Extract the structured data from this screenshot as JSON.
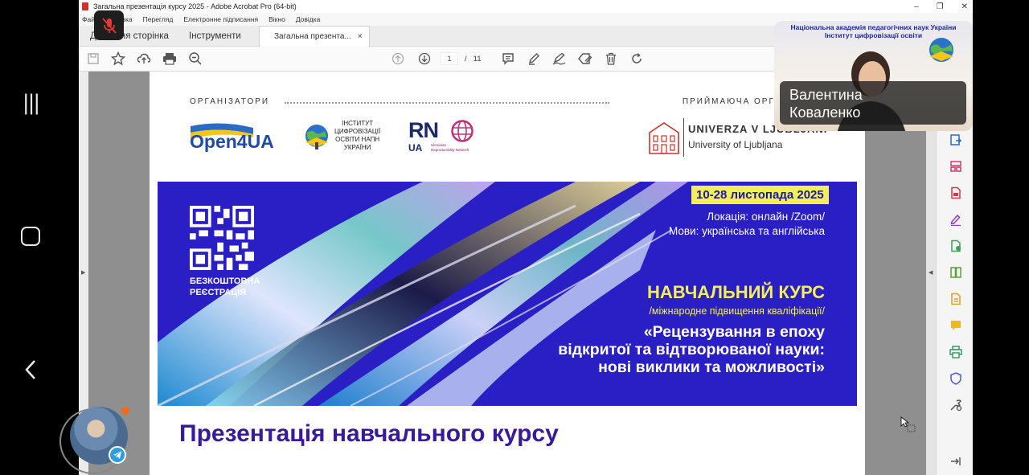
{
  "window": {
    "title": "Загальна презентація  курсу 2025 - Adobe Acrobat Pro (64-bit)",
    "controls": {
      "minimize": "–",
      "restore": "❐",
      "close": "✕"
    }
  },
  "menu": [
    "Файл",
    "Правка",
    "Перегляд",
    "Електронне підписання",
    "Вікно",
    "Довідка"
  ],
  "tabs": {
    "home": "Домашня сторінка",
    "tools": "Інструменти",
    "document": "Загальна презента...",
    "close": "×"
  },
  "pager": {
    "current": "1",
    "separator": "/",
    "total": "11"
  },
  "document": {
    "organizers_label": "ОРГАНІЗАТОРИ",
    "host_label": "ПРИЙМАЮЧА ОРГАНІЗАЦІЯ",
    "logos": {
      "open4ua": "Open4UA",
      "institute": [
        "ІНСТИТУТ",
        "ЦИФРОВІЗАЦІЇ",
        "ОСВІТИ НАПН",
        "УКРАЇНИ"
      ],
      "rn": "RN",
      "rn_ua": "UA",
      "rn_sub": [
        "Ukrainian",
        "Reproducibility Network"
      ],
      "ul_name": "UNIVERZA V LJUBLJANI",
      "ul_sub": "University of Ljubljana"
    },
    "banner": {
      "date": "10-28 листопада 2025",
      "location": "Локація: онлайн /Zoom/",
      "languages": "Мови: українська та англійська",
      "free_registration": [
        "БЕЗКОШТОВНА",
        "РЕЄСТРАЦІЯ"
      ],
      "course_label": "НАВЧАЛЬНИЙ КУРС",
      "course_sub": "/міжнародне підвищення кваліфікації/",
      "course_name": [
        "«Рецензування в епоху",
        "відкритої та відтворюваної науки:",
        "нові виклики та можливості»"
      ]
    },
    "heading": "Презентація навчального курсу"
  },
  "video": {
    "header": [
      "Національна академія педагогічних наук України",
      "Інститут цифровізації освіти"
    ],
    "name": [
      "Валентина",
      "Коваленко"
    ]
  },
  "colors": {
    "banner": "#2a1fc4",
    "badge": "#f2ee5c",
    "heading": "#3a1a9a"
  }
}
